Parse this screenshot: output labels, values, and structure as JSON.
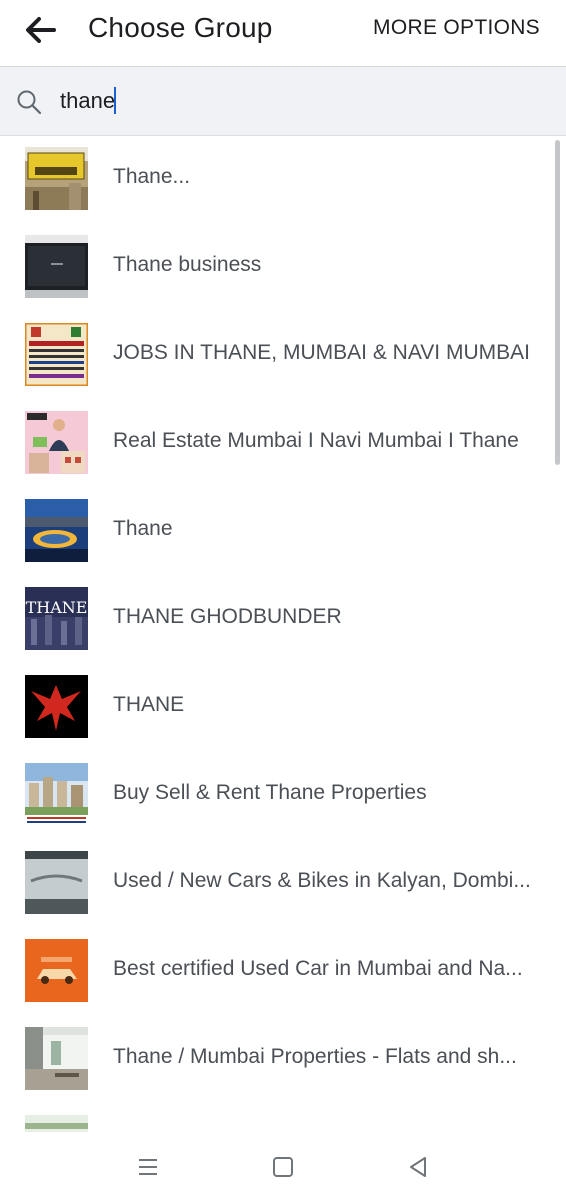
{
  "header": {
    "back_icon": "arrow-left-icon",
    "title": "Choose Group",
    "more_label": "MORE OPTIONS"
  },
  "search": {
    "icon": "search-icon",
    "value": "thane"
  },
  "groups": [
    {
      "label": "Thane...",
      "thumb": "thane-station-sign"
    },
    {
      "label": "Thane business",
      "thumb": "dark-monitor"
    },
    {
      "label": "JOBS IN THANE, MUMBAI & NAVI MUMBAI",
      "thumb": "jobs-flyer"
    },
    {
      "label": "Real Estate Mumbai I Navi Mumbai I Thane",
      "thumb": "real-estate-cartoon"
    },
    {
      "label": "Thane",
      "thumb": "city-night-lake"
    },
    {
      "label": "THANE GHODBUNDER",
      "thumb": "thane-text-skyline"
    },
    {
      "label": "THANE",
      "thumb": "red-eagle"
    },
    {
      "label": "Buy Sell & Rent Thane Properties",
      "thumb": "towers-ad"
    },
    {
      "label": "Used / New Cars & Bikes in Kalyan, Dombi...",
      "thumb": "car-windshield"
    },
    {
      "label": "Best certified Used Car in Mumbai and Na...",
      "thumb": "orange-car-logo"
    },
    {
      "label": "Thane / Mumbai Properties - Flats and sh...",
      "thumb": "balcony-interior"
    }
  ],
  "navbar": {
    "menu_icon": "menu-icon",
    "home_icon": "square-home-icon",
    "back_icon": "triangle-back-icon"
  }
}
